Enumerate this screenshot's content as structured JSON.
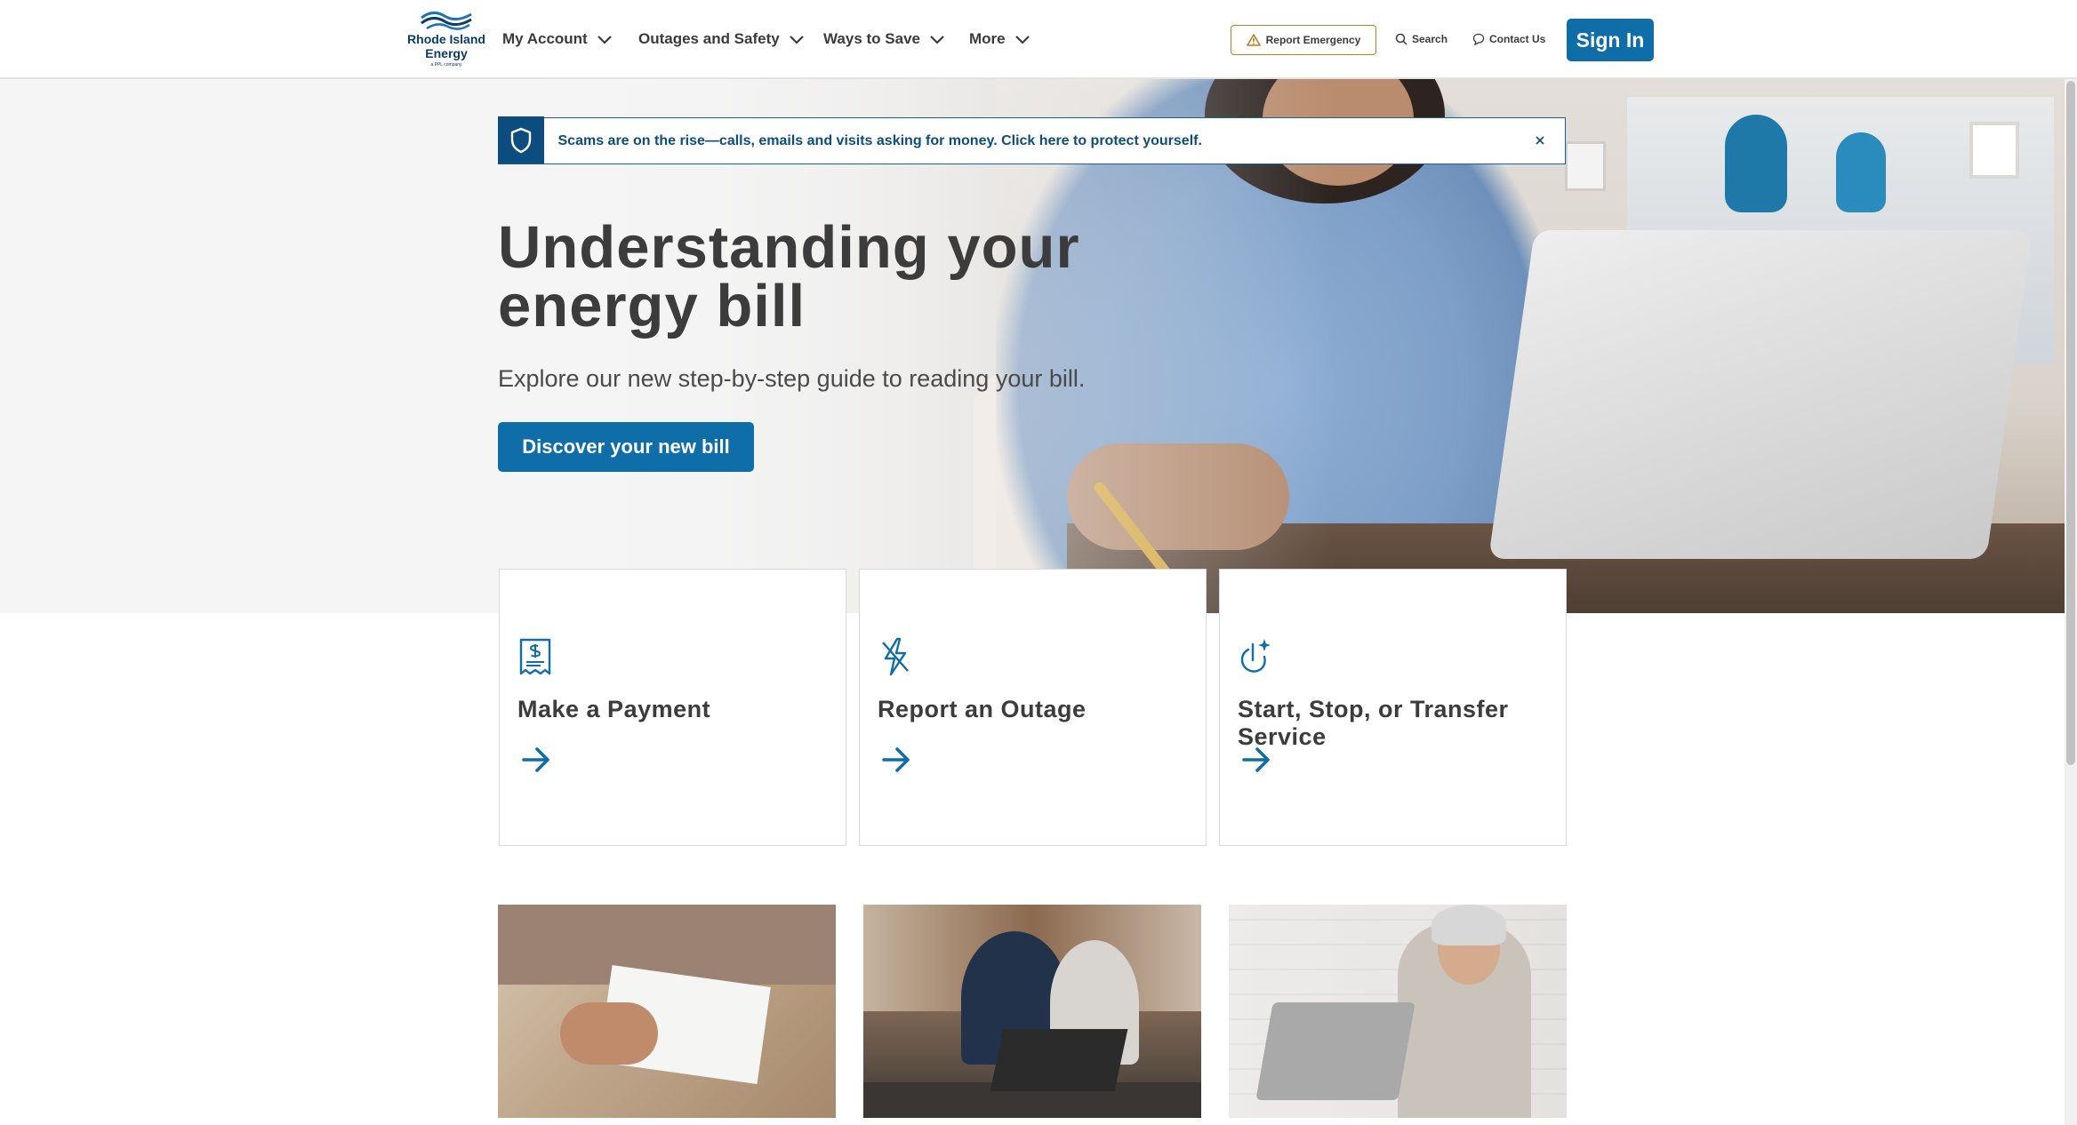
{
  "brand": {
    "line1": "Rhode Island",
    "line2": "Energy",
    "tagline": "a PPL company",
    "color": "#0a3c6b"
  },
  "nav": {
    "items": [
      {
        "label": "My Account"
      },
      {
        "label": "Outages and Safety"
      },
      {
        "label": "Ways to Save"
      },
      {
        "label": "More"
      }
    ]
  },
  "utility": {
    "report_emergency": "Report Emergency",
    "search": "Search",
    "contact": "Contact Us",
    "sign_in": "Sign In"
  },
  "alert": {
    "message": "Scams are on the rise—calls, emails and visits asking for money. Click here to protect yourself.",
    "icon": "shield-icon",
    "close_icon": "close-icon"
  },
  "hero": {
    "title": "Understanding your energy bill",
    "subtitle": "Explore our new step-by-step guide to reading your bill.",
    "cta": "Discover your new bill"
  },
  "cards": [
    {
      "title": "Make a Payment",
      "icon": "bill-payment-icon"
    },
    {
      "title": "Report an Outage",
      "icon": "power-outage-icon"
    },
    {
      "title": "Start, Stop, or Transfer Service",
      "icon": "power-toggle-icon"
    }
  ],
  "colors": {
    "primary": "#0f6da8",
    "dark_blue": "#0d4c7f",
    "emergency_border": "#c47a1f",
    "text": "#3c3c3c"
  }
}
